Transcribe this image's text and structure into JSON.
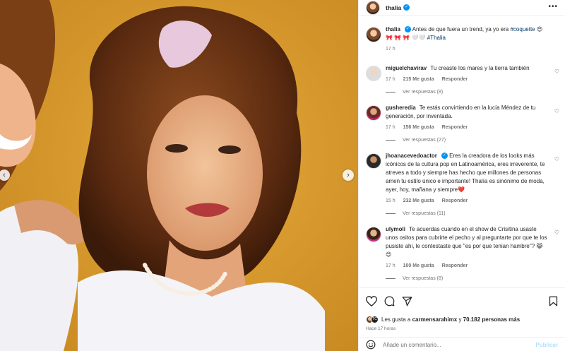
{
  "header": {
    "username": "thalia",
    "more": "•••"
  },
  "caption": {
    "username": "thalia",
    "text": "Antes de que fuera un trend, ya yo era",
    "tag1": "#coquette",
    "emoji1": "😍 🎀",
    "emoji2": "🎀 🎀 🤍🤍",
    "tag2": "#Thalia",
    "time": "17 h"
  },
  "comments": [
    {
      "username": "miguelchavirav",
      "text": "Tu creaste los mares y la tierra también",
      "time": "17 h",
      "likes": "215 Me gusta",
      "reply": "Responder",
      "view_replies": "Ver respuestas (8)",
      "verified": false
    },
    {
      "username": "gusheredia",
      "text": "Te estás convirtiendo en la lucía Méndez de tu generación, por inventada.",
      "time": "17 h",
      "likes": "156 Me gusta",
      "reply": "Responder",
      "view_replies": "Ver respuestas (27)",
      "verified": false
    },
    {
      "username": "jhoanacevedoactor",
      "text": "Eres la creadora de los looks más icónicos de la cultura pop en Latinoamérica, eres irreverente, te atreves a todo y siempre has hecho que millones de personas amen tu estilo único e importante! Thalía es sinónimo de moda, ayer, hoy, mañana y siempre❤️",
      "time": "15 h",
      "likes": "232 Me gusta",
      "reply": "Responder",
      "view_replies": "Ver respuestas (11)",
      "verified": true
    },
    {
      "username": "ulymoli",
      "text": "Te acuerdas cuando en el show de Crisitina usaste unos ositos para cubrirte el pecho y al preguntarte por que te los pusiste ahi, le contestaste que \"es por que tenian hambre\"? 😹 😍",
      "time": "17 h",
      "likes": "100 Me gusta",
      "reply": "Responder",
      "view_replies": "Ver respuestas (8)",
      "verified": false
    }
  ],
  "likes": {
    "prefix": "Les gusta a",
    "user": "carmensarahimx",
    "middle": "y",
    "count": "70.182 personas más"
  },
  "ago": "Hace 17 horas",
  "add_comment": {
    "placeholder": "Añade un comentario...",
    "publish": "Publicar"
  },
  "colors": {
    "verified": "#0095f6",
    "tag": "#00376b",
    "publish_disabled": "#b2dffc"
  }
}
